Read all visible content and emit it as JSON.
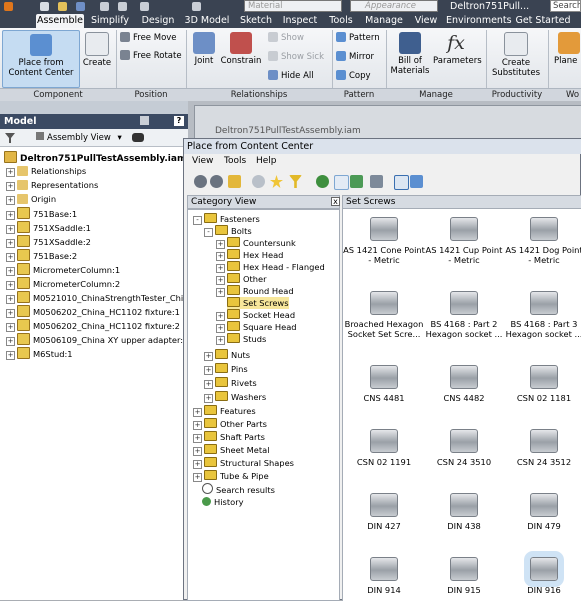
{
  "window": {
    "title": "Deltron751Pull...",
    "material_value": "Material",
    "appearance_value": "Appearance",
    "search_placeholder": "Search"
  },
  "tabs": [
    "Assemble",
    "Simplify",
    "Design",
    "3D Model",
    "Sketch",
    "Inspect",
    "Tools",
    "Manage",
    "View",
    "Environments",
    "Get Started"
  ],
  "ribbon": {
    "component": {
      "place_from_cc": "Place from Content Center",
      "create": "Create",
      "group": "Component"
    },
    "position": {
      "free_move": "Free Move",
      "free_rotate": "Free Rotate",
      "group": "Position"
    },
    "relationships": {
      "joint": "Joint",
      "constrain": "Constrain",
      "show": "Show",
      "show_sick": "Show Sick",
      "hide_all": "Hide All",
      "group": "Relationships"
    },
    "pattern": {
      "pattern": "Pattern",
      "mirror": "Mirror",
      "copy": "Copy",
      "group": "Pattern"
    },
    "manage": {
      "bill_of_materials": "Bill of Materials",
      "parameters": "Parameters",
      "group": "Manage"
    },
    "productivity": {
      "create_substitutes": "Create Substitutes",
      "group": "Productivity"
    },
    "planes": {
      "label": "Plane",
      "group": "Wo"
    }
  },
  "model_browser": {
    "title": "Model",
    "view_label": "Assembly View",
    "root": "Deltron751PullTestAssembly.iam",
    "items": [
      "Relationships",
      "Representations",
      "Origin",
      "751Base:1",
      "751XSaddle:1",
      "751XSaddle:2",
      "751Base:2",
      "MicrometerColumn:1",
      "MicrometerColumn:2",
      "M0521010_ChinaStrengthTester_China",
      "M0506202_China_HC1102 fixture:1",
      "M0506202_China_HC1102 fixture:2",
      "M0506109_China XY upper adapter:1",
      "M6Stud:1"
    ]
  },
  "background_doc": {
    "title": "Deltron751PullTestAssembly.iam"
  },
  "dialog": {
    "title": "Place from Content Center",
    "menu": [
      "View",
      "Tools",
      "Help"
    ],
    "category_header": "Category View",
    "close_glyph": "x",
    "categories": [
      {
        "label": "Fasteners",
        "level": 0,
        "exp": "-"
      },
      {
        "label": "Bolts",
        "level": 1,
        "exp": "-"
      },
      {
        "label": "Countersunk",
        "level": 2,
        "exp": "+"
      },
      {
        "label": "Hex Head",
        "level": 2,
        "exp": "+"
      },
      {
        "label": "Hex Head - Flanged",
        "level": 2,
        "exp": "+"
      },
      {
        "label": "Other",
        "level": 2,
        "exp": "+"
      },
      {
        "label": "Round Head",
        "level": 2,
        "exp": "+"
      },
      {
        "label": "Set Screws",
        "level": 2,
        "exp": "",
        "selected": true
      },
      {
        "label": "Socket Head",
        "level": 2,
        "exp": "+"
      },
      {
        "label": "Square Head",
        "level": 2,
        "exp": "+"
      },
      {
        "label": "Studs",
        "level": 2,
        "exp": "+"
      },
      {
        "label": "Nuts",
        "level": 1,
        "exp": "+"
      },
      {
        "label": "Pins",
        "level": 1,
        "exp": "+"
      },
      {
        "label": "Rivets",
        "level": 1,
        "exp": "+"
      },
      {
        "label": "Washers",
        "level": 1,
        "exp": "+"
      },
      {
        "label": "Features",
        "level": 0,
        "exp": "+"
      },
      {
        "label": "Other Parts",
        "level": 0,
        "exp": "+"
      },
      {
        "label": "Shaft Parts",
        "level": 0,
        "exp": "+"
      },
      {
        "label": "Sheet Metal",
        "level": 0,
        "exp": "+"
      },
      {
        "label": "Structural Shapes",
        "level": 0,
        "exp": "+"
      },
      {
        "label": "Tube & Pipe",
        "level": 0,
        "exp": "+"
      },
      {
        "label": "Search results",
        "level": 0,
        "exp": ""
      },
      {
        "label": "History",
        "level": 0,
        "exp": ""
      }
    ],
    "family_header": "Set Screws",
    "families": [
      "AS 1421 Cone Point - Metric",
      "AS 1421 Cup Point - Metric",
      "AS 1421 Dog Point - Metric",
      "Broached Hexagon Socket Set Scre...",
      "BS 4168 : Part 2 Hexagon socket ...",
      "BS 4168 : Part 3 Hexagon socket ...",
      "CNS 4481",
      "CNS 4482",
      "CSN 02 1181",
      "CSN 02 1191",
      "CSN 24 3510",
      "CSN 24 3512",
      "DIN 427",
      "DIN 438",
      "DIN 479",
      "DIN 914",
      "DIN 915",
      "DIN 916"
    ]
  }
}
